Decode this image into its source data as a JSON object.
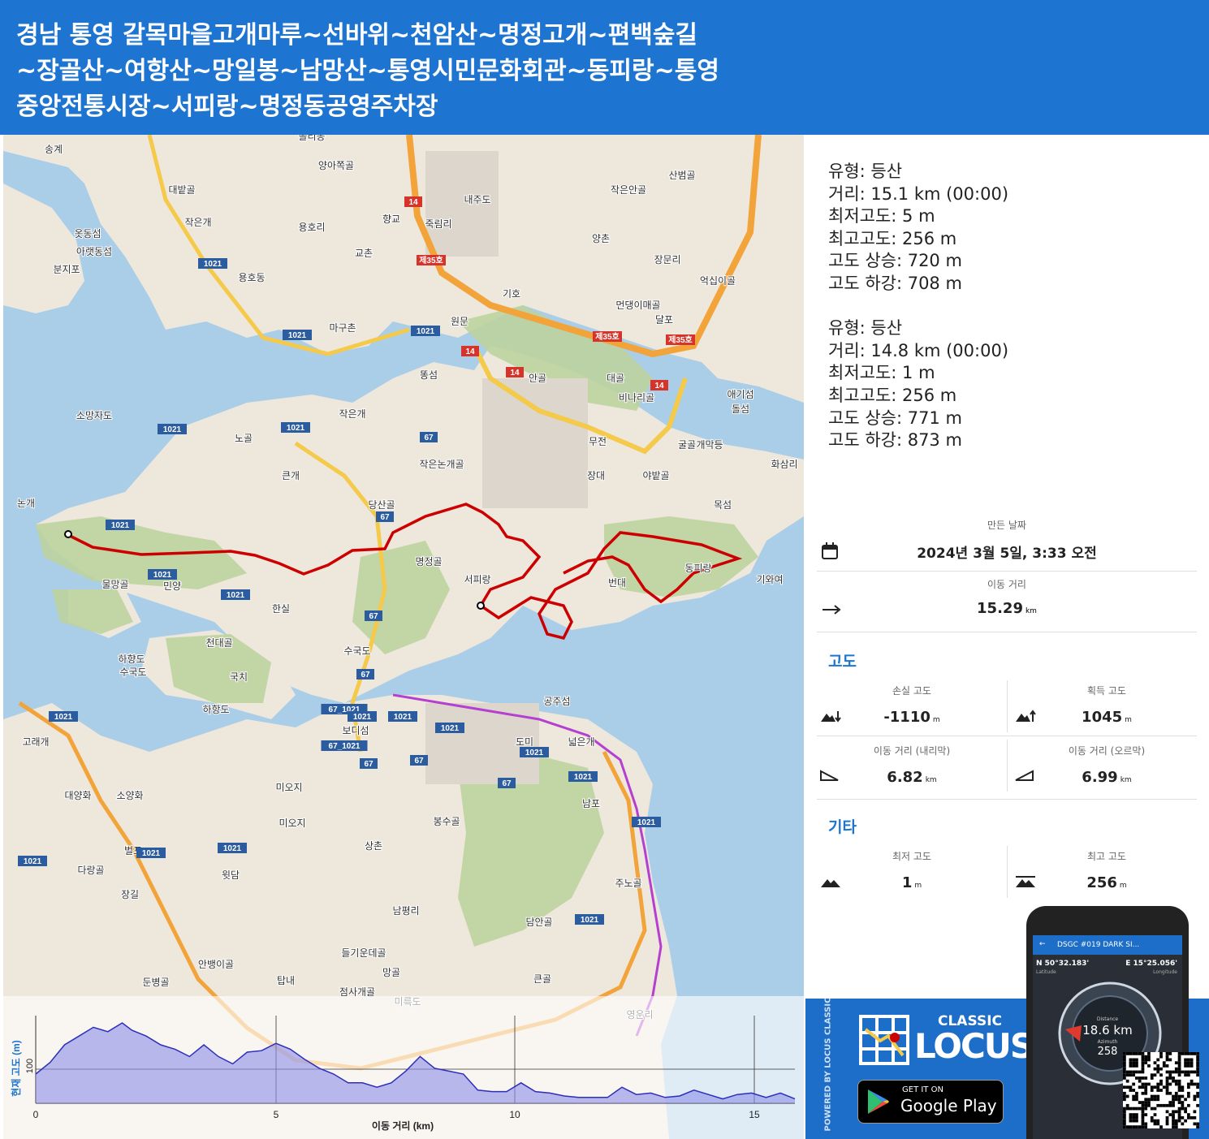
{
  "header": {
    "title_lines": [
      "경남 통영 갈목마을고개마루~선바위~천암산~명정고개~편백숲길",
      "~장골산~여항산~망일봉~남망산~통영시민문화회관~동피랑~통영",
      "중앙전통시장~서피랑~명정동공영주차장"
    ]
  },
  "map": {
    "places": [
      "송계",
      "올리동",
      "양아쪽골",
      "대밭골",
      "작은개",
      "용호리",
      "옷동섬",
      "아랫동섬",
      "분지포",
      "용호동",
      "교촌",
      "향교",
      "죽림리",
      "내주도",
      "산범골",
      "작은안골",
      "장문리",
      "양촌",
      "억십이골",
      "기호",
      "원문",
      "먼댕이매골",
      "달포",
      "마구촌",
      "똥섬",
      "안골",
      "대골",
      "비나리골",
      "애기섬",
      "돌섬",
      "소망자도",
      "작은개",
      "노골",
      "큰개",
      "작은논개골",
      "무전",
      "굴골",
      "개막등",
      "화삼리",
      "장대",
      "야밭골",
      "목섬",
      "논개",
      "당산골",
      "명정골",
      "서피랑",
      "물망골",
      "민양",
      "한실",
      "번대",
      "동피랑",
      "기와여",
      "천대골",
      "하향도",
      "수국도",
      "수국도",
      "국치",
      "공주섬",
      "하항도",
      "보디섬",
      "도미",
      "넓은개",
      "고래개",
      "미오지",
      "미오지",
      "대양화",
      "소양화",
      "남포",
      "봉수골",
      "상촌",
      "벌포",
      "다랑골",
      "윗담",
      "장길",
      "주노골",
      "남평리",
      "담안골",
      "안뱅이골",
      "들기운데골",
      "망골",
      "탑내",
      "둔병골",
      "점사개골",
      "미륵도",
      "큰골",
      "영운리"
    ],
    "road_labels": [
      "14",
      "제35호",
      "1021",
      "67",
      "67_1021"
    ],
    "chart_data": {
      "type": "area",
      "title": "",
      "xlabel": "이동 거리 (km)",
      "ylabel": "현재 고도 (m)",
      "x_ticks": [
        "0",
        "5",
        "10",
        "15"
      ],
      "y_ticks": [
        "100"
      ],
      "xlim": [
        0,
        15.8
      ],
      "ylim": [
        0,
        300
      ],
      "series": [
        {
          "x": [
            0,
            0.3,
            0.6,
            0.9,
            1.2,
            1.5,
            1.8,
            2.0,
            2.3,
            2.6,
            2.9,
            3.2,
            3.5,
            3.8,
            4.1,
            4.4,
            4.7,
            5.0,
            5.3,
            5.6,
            5.9,
            6.2,
            6.5,
            6.8,
            7.1,
            7.4,
            7.7,
            8.0,
            8.3,
            8.6,
            8.9,
            9.2,
            9.5,
            9.8,
            10.1,
            10.4,
            10.7,
            11.0,
            11.3,
            11.6,
            11.9,
            12.2,
            12.5,
            12.8,
            13.1,
            13.4,
            13.7,
            14.0,
            14.3,
            14.6,
            14.9,
            15.2,
            15.5,
            15.8
          ],
          "y": [
            100,
            140,
            200,
            230,
            260,
            245,
            275,
            250,
            230,
            200,
            185,
            160,
            200,
            160,
            135,
            175,
            180,
            205,
            185,
            150,
            120,
            100,
            70,
            70,
            55,
            70,
            110,
            160,
            120,
            110,
            100,
            45,
            40,
            40,
            70,
            40,
            35,
            25,
            20,
            20,
            20,
            55,
            30,
            35,
            20,
            25,
            45,
            30,
            15,
            30,
            35,
            20,
            35,
            15
          ]
        }
      ]
    }
  },
  "stats": {
    "group1": [
      "유형: 등산",
      "거리: 15.1 km (00:00)",
      "최저고도: 5 m",
      "최고고도: 256 m",
      "고도 상승: 720 m",
      "고도 하강: 708 m"
    ],
    "group2": [
      "유형: 등산",
      "거리: 14.8 km (00:00)",
      "최저고도: 1 m",
      "최고고도: 256 m",
      "고도 상승: 771 m",
      "고도 하강: 873 m"
    ]
  },
  "summary": {
    "created_label": "만든 날짜",
    "created_value": "2024년 3월 5일, 3:33 오전",
    "distance_label": "이동 거리",
    "distance_value": "15.29",
    "distance_unit": "km",
    "elevation_section": "고도",
    "loss_label": "손실 고도",
    "loss_value": "-1110",
    "loss_unit": "m",
    "gain_label": "획득 고도",
    "gain_value": "1045",
    "gain_unit": "m",
    "down_label": "이동 거리 (내리막)",
    "down_value": "6.82",
    "down_unit": "km",
    "up_label": "이동 거리 (오르막)",
    "up_value": "6.99",
    "up_unit": "km",
    "other_section": "기타",
    "min_label": "최저 고도",
    "min_value": "1",
    "min_unit": "m",
    "max_label": "최고 고도",
    "max_value": "256",
    "max_unit": "m"
  },
  "brand": {
    "powered": "POWERED BY LOCUS CLASSIC",
    "classic": "CLASSIC",
    "locus": "LOCUS",
    "get_it_on": "GET IT ON",
    "google_play": "Google Play",
    "phone_title": "DSGC #019 DARK SI...",
    "lat": "N 50°32.183'",
    "lat_lbl": "Latitude",
    "lon": "E 15°25.056'",
    "lon_lbl": "Longitude",
    "distance_lbl": "Distance",
    "distance_val": "18.6 km",
    "azimuth_lbl": "Azimuth",
    "azimuth_val": "258"
  },
  "colors": {
    "header": "#1d75d1",
    "track": "#cc0000",
    "profile_fill": "#8c8ee8",
    "profile_line": "#2c2fb8"
  }
}
